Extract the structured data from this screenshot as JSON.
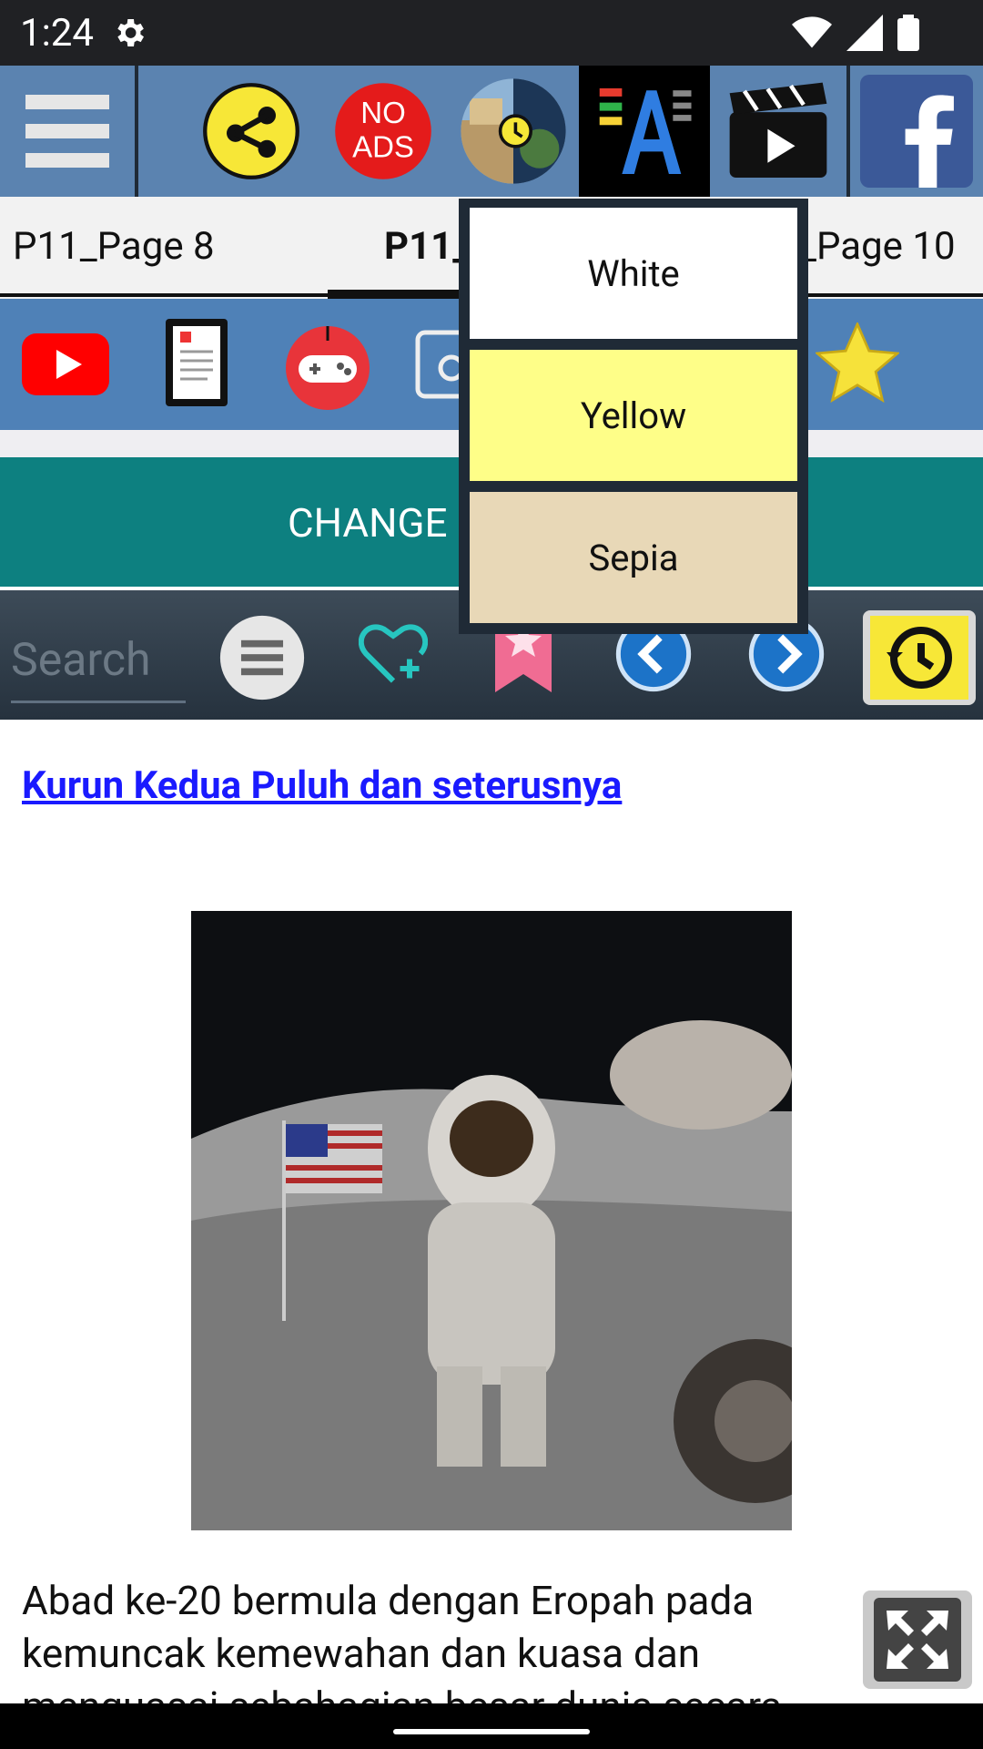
{
  "status_bar": {
    "time": "1:24"
  },
  "toolbar": {
    "no_ads_line1": "NO",
    "no_ads_line2": "ADS",
    "items": [
      "menu-icon",
      "share-icon",
      "no-ads-button",
      "history-icon",
      "font-size-icon",
      "video-icon",
      "facebook-icon"
    ]
  },
  "tabs": [
    {
      "label": "P11_Page 8"
    },
    {
      "label": "P11_"
    },
    {
      "label": "_Page 10"
    }
  ],
  "change_button": {
    "label": "CHANGE"
  },
  "search": {
    "placeholder": "Search"
  },
  "content": {
    "title": "Kurun Kedua Puluh dan seterusnya",
    "paragraph": "Abad ke-20 bermula dengan Eropah pada kemuncak kemewahan dan kuasa dan menguasai sebahagian besar dunia secara"
  },
  "dropdown": {
    "options": [
      {
        "label": "White",
        "color": "#ffffff"
      },
      {
        "label": "Yellow",
        "color": "#fefe88"
      },
      {
        "label": "Sepia",
        "color": "#e8d8b7"
      }
    ]
  },
  "colors": {
    "toolbar": "#5b83b0",
    "iconbar": "#4f81b7",
    "change": "#0d8080",
    "link": "#1a1aff"
  }
}
